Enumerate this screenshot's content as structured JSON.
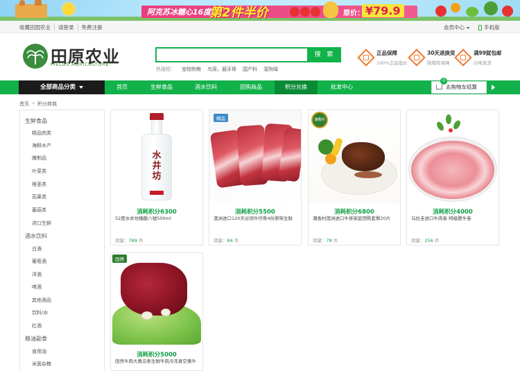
{
  "banner": {
    "headline": "阿克苏冰糖心16度甜",
    "offer": "第2件半价",
    "price_label": "原价：",
    "price": "¥79.9"
  },
  "topbar": {
    "links": [
      "收藏田园农业",
      "请登录",
      "免费注册"
    ],
    "member_center": "会员中心",
    "mobile": "手机版"
  },
  "header": {
    "logo_text": "田原农业",
    "logo_sub": "FIELDS AGRICULTURE",
    "search_placeholder": "",
    "search_button": "搜 索",
    "hot_label": "热搜榜：",
    "hot_terms": [
      "宠物狗粮",
      "鸟笼，磨牙棒",
      "国产料",
      "溜狗绳"
    ],
    "promises": [
      {
        "title": "正品保障",
        "sub": "100%正品低价"
      },
      {
        "title": "30天退换货",
        "sub": "购物有保障"
      },
      {
        "title": "满99就包邮",
        "sub": "闪电发货"
      }
    ]
  },
  "nav": {
    "all_categories": "全部商品分类",
    "items": [
      "首页",
      "生鲜食品",
      "酒水饮料",
      "团购商品",
      "积分兑换",
      "批发中心"
    ],
    "active_index": 4,
    "cart_label": "去购物车结算",
    "cart_count": "0"
  },
  "breadcrumb": [
    "首页",
    "积分商城"
  ],
  "sidebar": {
    "groups": [
      {
        "title": "生鲜食品",
        "items": [
          "精品肉类",
          "海鲜水产",
          "腌制品",
          "叶菜类",
          "根茎类",
          "茄果类",
          "菌菇类",
          "进口生鲜"
        ]
      },
      {
        "title": "酒水饮料",
        "items": [
          "白酒",
          "葡萄酒",
          "洋酒",
          "啤酒",
          "其他酒品",
          "饮料/水",
          "红酒"
        ]
      },
      {
        "title": "粮油副食",
        "items": [
          "食用油",
          "米面杂粮"
        ]
      }
    ]
  },
  "products": [
    {
      "points": "消耗积分6300",
      "name": "52度水井坊臻酿八號500ml",
      "sales_label": "销量：",
      "sales": "789",
      "unit": "件"
    },
    {
      "points": "消耗积分5500",
      "name": "澳洲进口120天谷饲牛仔骨4份原味生鲜",
      "sales_label": "销量：",
      "sales": "84",
      "unit": "件",
      "brand_tag": "精品"
    },
    {
      "points": "消耗积分6800",
      "name": "潮香村澳洲进口牛排家庭团购套餐20片",
      "sales_label": "销量：",
      "sales": "78",
      "unit": "件",
      "brand_tag": "潮香村"
    },
    {
      "points": "消耗积分4000",
      "name": "乌拉圭进口牛肉卷 特级肥牛卷",
      "sales_label": "销量：",
      "sales": "256",
      "unit": "件"
    },
    {
      "points": "消耗积分5000",
      "name": "田然牛肉大黄瓜条生鲜牛肉冷冻真空黄牛",
      "brand_tag": "田然"
    }
  ],
  "colors": {
    "brand_green": "#12b24a",
    "nav_dark": "#1b1b1b",
    "points_green": "#12a044",
    "promise_orange": "#f07a2c"
  }
}
